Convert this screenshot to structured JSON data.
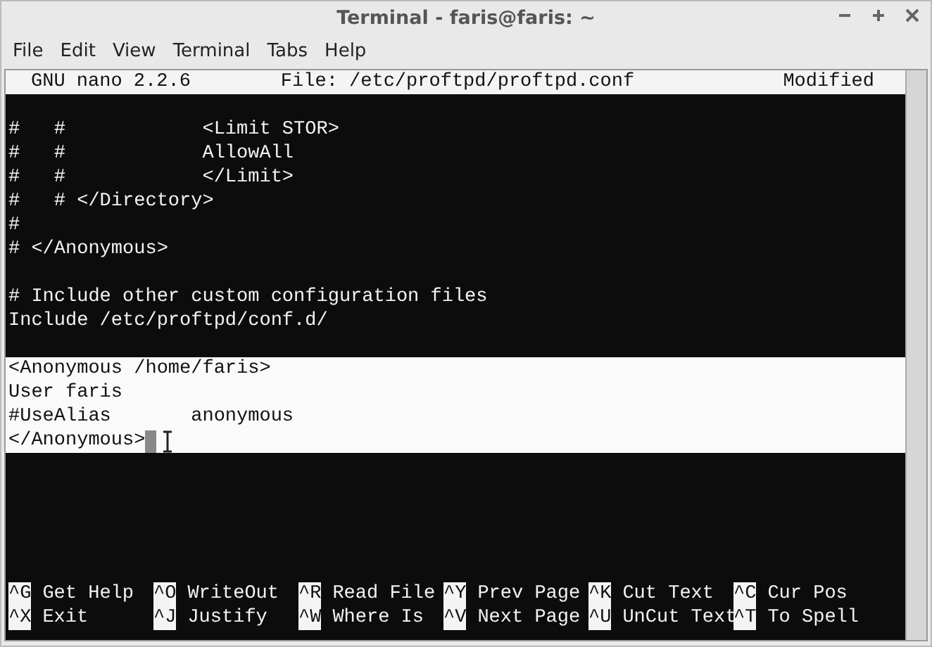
{
  "window": {
    "title": "Terminal - faris@faris: ~"
  },
  "menu": [
    "File",
    "Edit",
    "View",
    "Terminal",
    "Tabs",
    "Help"
  ],
  "nano_header": {
    "version": "GNU nano 2.2.6",
    "file": "File: /etc/proftpd/proftpd.conf",
    "status": "Modified"
  },
  "lines": [
    {
      "selected": false
    },
    {
      "text": "#   #            <Limit STOR>",
      "selected": false
    },
    {
      "text": "#   #            AllowAll",
      "selected": false
    },
    {
      "text": "#   #            </Limit>",
      "selected": false
    },
    {
      "text": "#   # </Directory>",
      "selected": false
    },
    {
      "text": "#",
      "selected": false
    },
    {
      "text": "# </Anonymous>",
      "selected": false
    },
    {
      "selected": false
    },
    {
      "text": "# Include other custom configuration files",
      "selected": false
    },
    {
      "text": "Include /etc/proftpd/conf.d/",
      "selected": false
    },
    {
      "selected": false
    },
    {
      "text": "<Anonymous /home/faris>",
      "selected": true
    },
    {
      "text": "User faris",
      "selected": true
    },
    {
      "text": "#UseAlias       anonymous",
      "selected": true
    },
    {
      "text": "</Anonymous>",
      "selected": true,
      "cursor": true
    }
  ],
  "shortcuts": [
    {
      "key": "^G",
      "label": "Get Help"
    },
    {
      "key": "^O",
      "label": "WriteOut"
    },
    {
      "key": "^R",
      "label": "Read File"
    },
    {
      "key": "^Y",
      "label": "Prev Page"
    },
    {
      "key": "^K",
      "label": "Cut Text"
    },
    {
      "key": "^C",
      "label": "Cur Pos"
    },
    {
      "key": "^X",
      "label": "Exit"
    },
    {
      "key": "^J",
      "label": "Justify"
    },
    {
      "key": "^W",
      "label": "Where Is"
    },
    {
      "key": "^V",
      "label": "Next Page"
    },
    {
      "key": "^U",
      "label": "UnCut Text"
    },
    {
      "key": "^T",
      "label": "To Spell"
    }
  ]
}
